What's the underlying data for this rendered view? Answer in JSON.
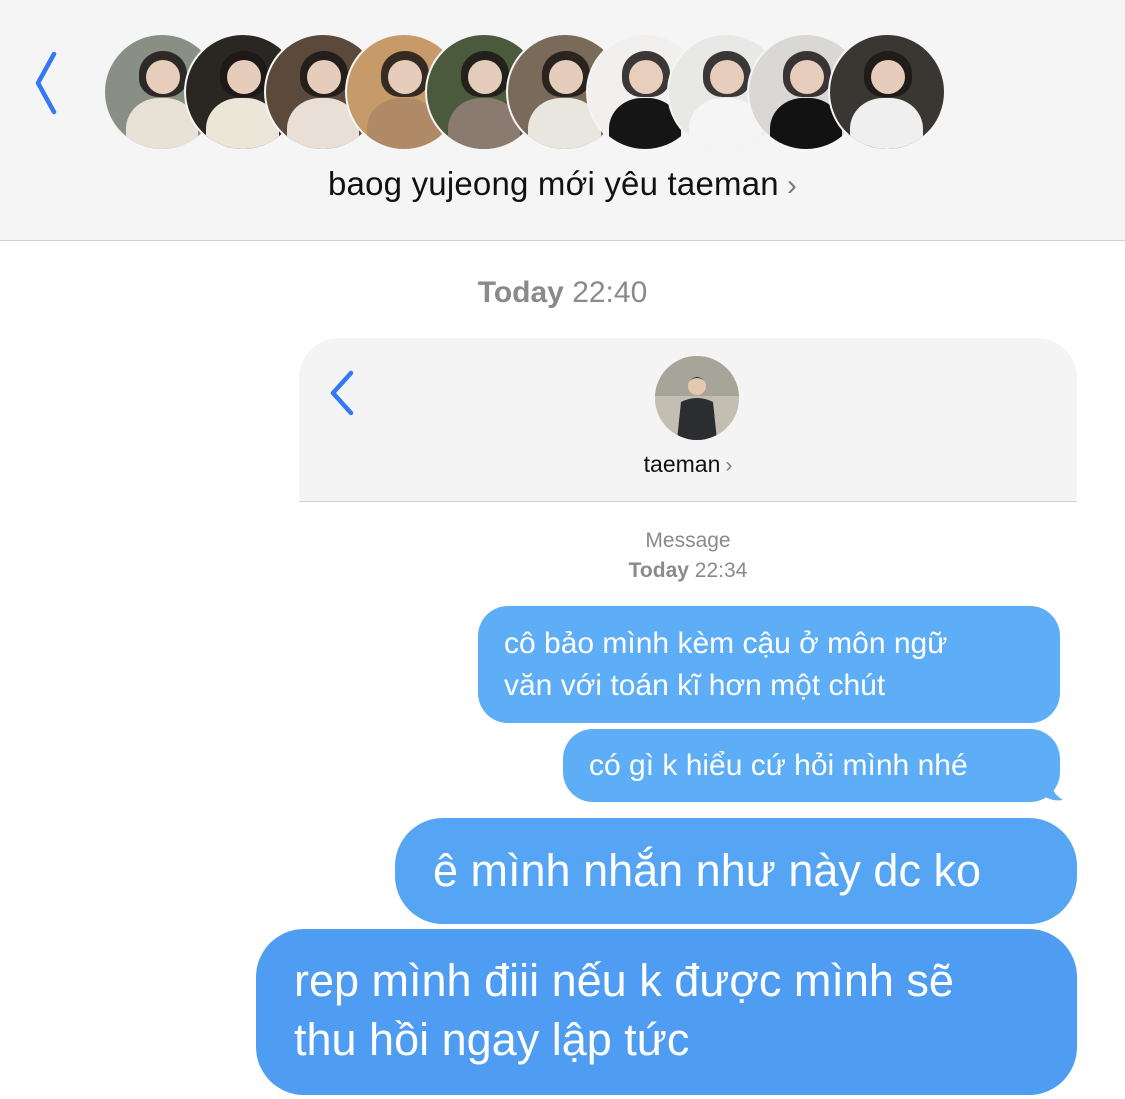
{
  "header": {
    "group_name": "baog yujeong mới yêu taeman",
    "chevron": "›",
    "avatars": [
      {
        "bg": "#8a8f86",
        "body": "#e8e2d6"
      },
      {
        "bg": "#2a2622",
        "body": "#ebe6d8"
      },
      {
        "bg": "#5b4a3c",
        "body": "#e9dfd6"
      },
      {
        "bg": "#c79a6a",
        "body": "#b08a66"
      },
      {
        "bg": "#4b5a3c",
        "body": "#8b7a70"
      },
      {
        "bg": "#7a6a5a",
        "body": "#e9e6e0"
      },
      {
        "bg": "#f2f0ee",
        "body": "#151515"
      },
      {
        "bg": "#e8e8e6",
        "body": "#f5f5f5"
      },
      {
        "bg": "#dad8d4",
        "body": "#121212"
      },
      {
        "bg": "#3a3632",
        "body": "#efefef"
      }
    ]
  },
  "timestamp": {
    "day": "Today",
    "time": "22:40"
  },
  "card": {
    "contact_name": "taeman",
    "chevron": "›",
    "meta_label": "Message",
    "meta_day": "Today",
    "meta_time": "22:34"
  },
  "messages": [
    {
      "text_line1": "cô bảo mình kèm cậu ở môn ngữ",
      "text_line2": "văn với toán kĩ hơn một chút"
    },
    {
      "text": "có gì k hiểu cứ hỏi mình nhé"
    },
    {
      "text": "ê mình nhắn như này dc ko"
    },
    {
      "text_line1": "rep mình điii nếu k được mình sẽ",
      "text_line2": "thu hồi ngay lập tức"
    }
  ],
  "colors": {
    "accent_blue": "#3478f6",
    "bubble_blue": "#5aaaf5",
    "header_bg": "#f5f5f6",
    "meta_gray": "#8a8a8e"
  },
  "icons": {
    "back": "chevron-left-icon",
    "disclosure": "chevron-right-icon"
  }
}
